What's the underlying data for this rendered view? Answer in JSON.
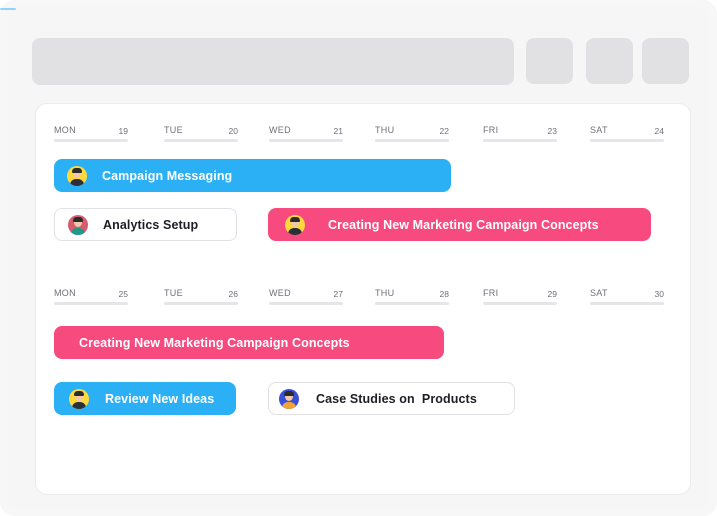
{
  "week1": {
    "days": [
      {
        "name": "MON",
        "num": "19"
      },
      {
        "name": "TUE",
        "num": "20"
      },
      {
        "name": "WED",
        "num": "21"
      },
      {
        "name": "THU",
        "num": "22"
      },
      {
        "name": "FRI",
        "num": "23"
      },
      {
        "name": "SAT",
        "num": "24"
      }
    ],
    "events": {
      "campaign_messaging": "Campaign Messaging",
      "analytics_setup": "Analytics Setup",
      "creating_concepts": "Creating New Marketing Campaign Concepts"
    }
  },
  "week2": {
    "days": [
      {
        "name": "MON",
        "num": "25"
      },
      {
        "name": "TUE",
        "num": "26"
      },
      {
        "name": "WED",
        "num": "27"
      },
      {
        "name": "THU",
        "num": "28"
      },
      {
        "name": "FRI",
        "num": "29"
      },
      {
        "name": "SAT",
        "num": "30"
      }
    ],
    "events": {
      "creating_concepts": "Creating New Marketing Campaign Concepts",
      "review_ideas": "Review New Ideas",
      "case_studies": "Case Studies on  Products"
    }
  },
  "colors": {
    "blue_event": "#2bb0f5",
    "pink_event": "#f74a7f",
    "placeholder": "#e1e1e4"
  },
  "icons": {
    "avatar": "user-avatar-icon"
  }
}
